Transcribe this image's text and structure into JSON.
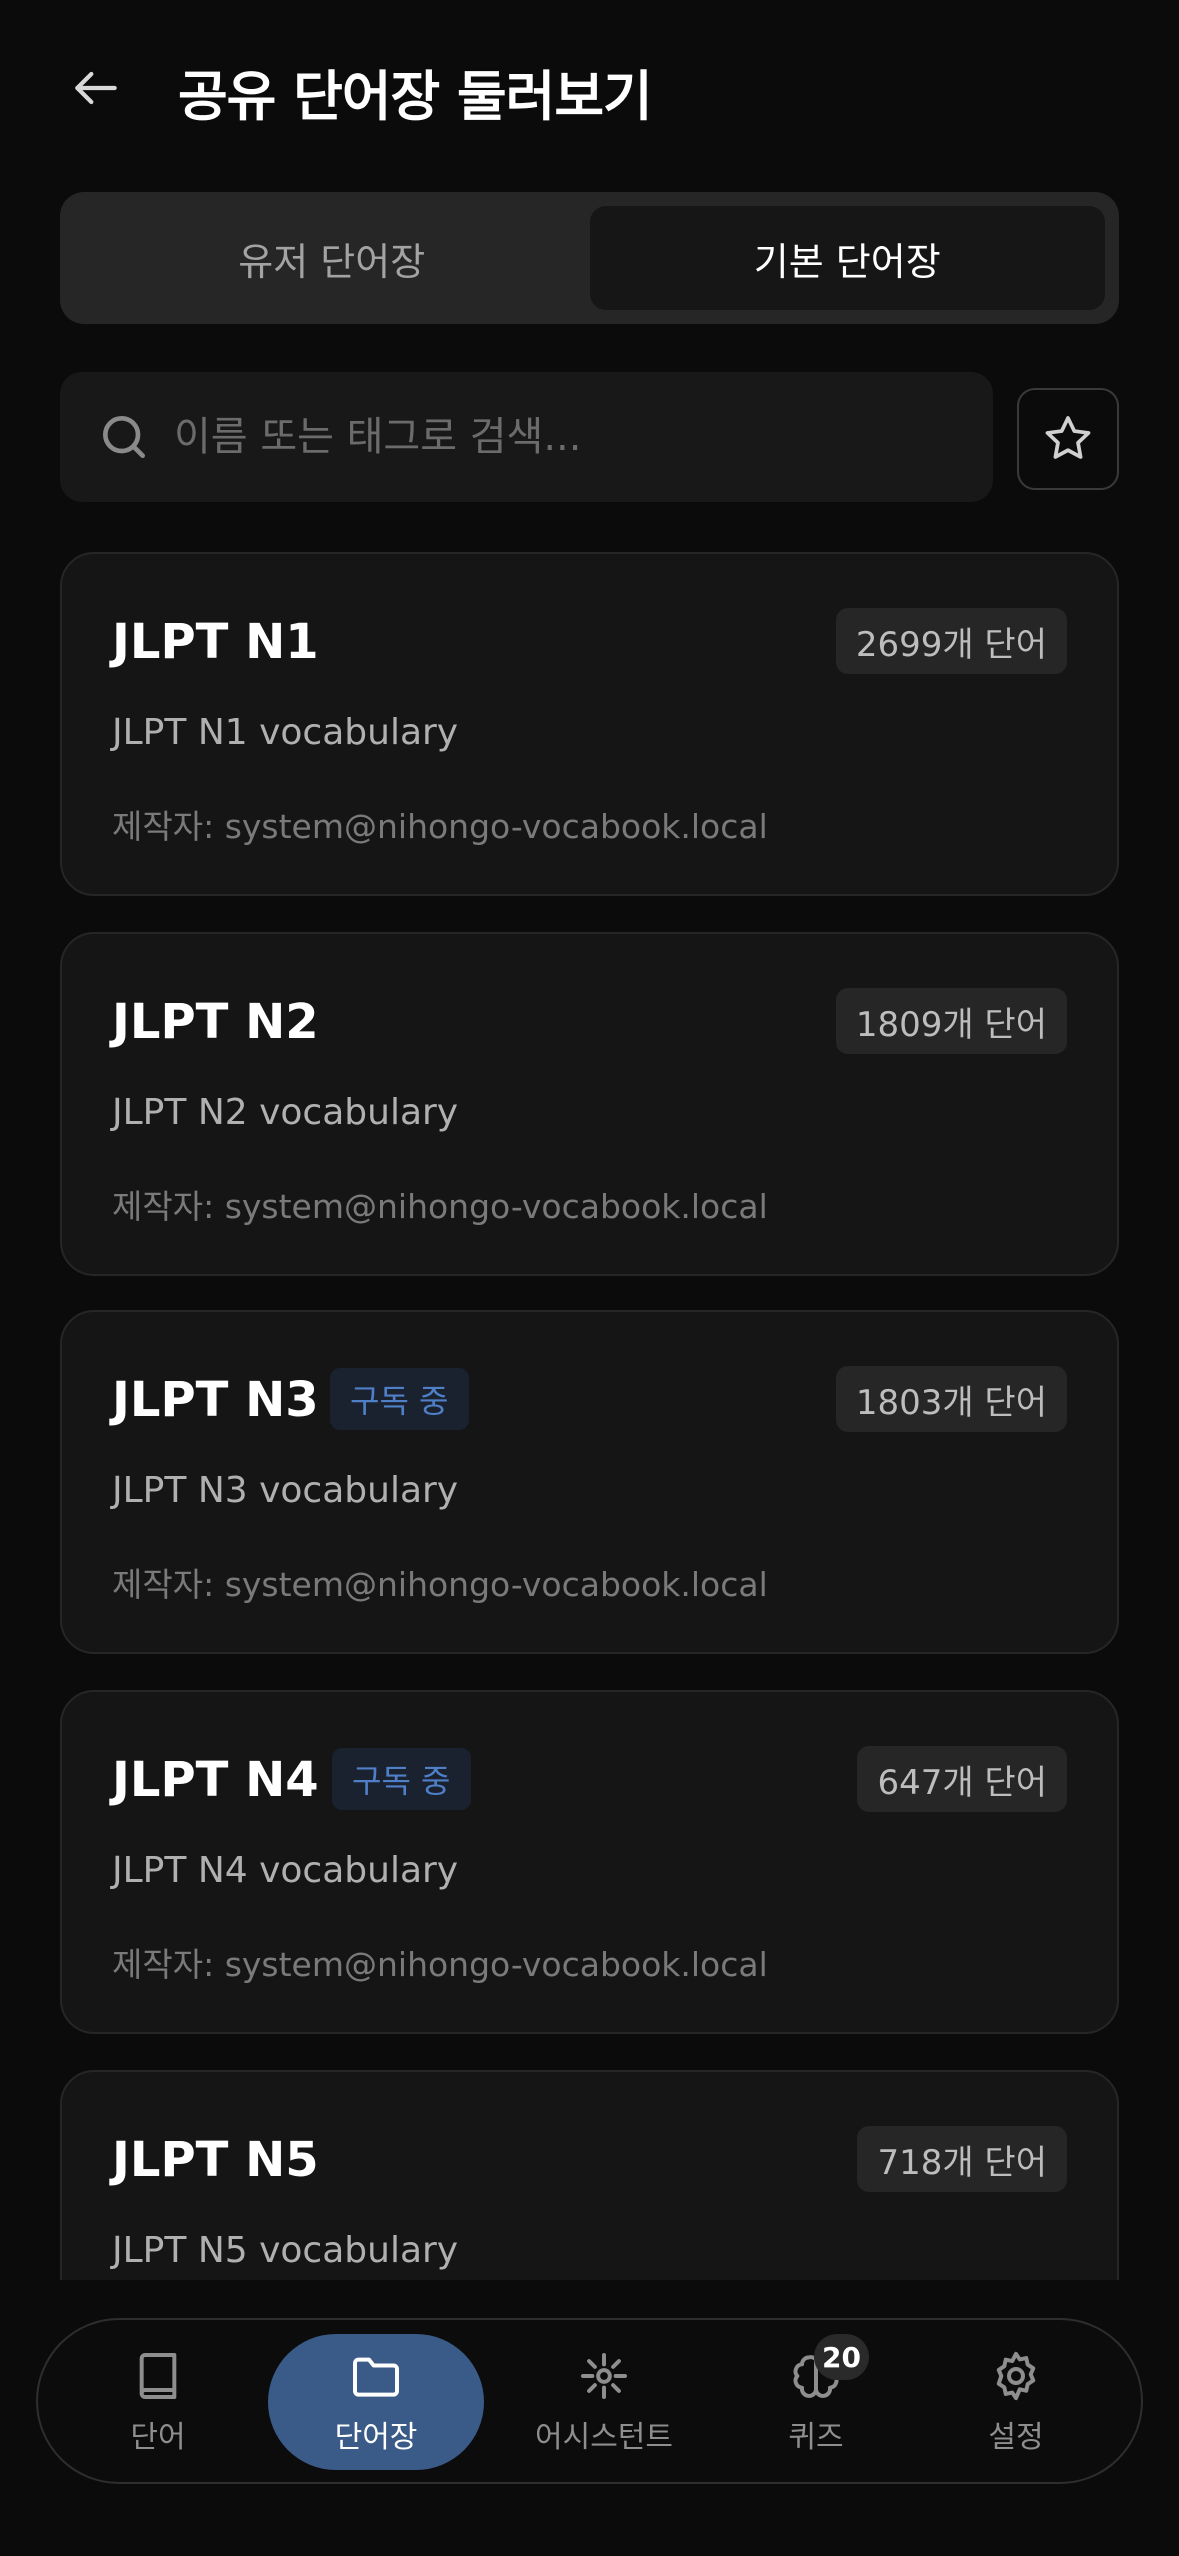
{
  "header": {
    "title": "공유 단어장 둘러보기",
    "back_icon": "arrow-left-icon"
  },
  "tabs": [
    {
      "label": "유저 단어장",
      "active": false
    },
    {
      "label": "기본 단어장",
      "active": true
    }
  ],
  "search": {
    "placeholder": "이름 또는 태그로 검색...",
    "value": ""
  },
  "favorites_icon": "star-icon",
  "vocabooks": [
    {
      "title": "JLPT N1",
      "badge": "",
      "count": "2699개 단어",
      "description": "JLPT N1 vocabulary",
      "author": "제작자: system@nihongo-vocabook.local"
    },
    {
      "title": "JLPT N2",
      "badge": "",
      "count": "1809개 단어",
      "description": "JLPT N2 vocabulary",
      "author": "제작자: system@nihongo-vocabook.local"
    },
    {
      "title": "JLPT N3",
      "badge": "구독 중",
      "count": "1803개 단어",
      "description": "JLPT N3 vocabulary",
      "author": "제작자: system@nihongo-vocabook.local"
    },
    {
      "title": "JLPT N4",
      "badge": "구독 중",
      "count": "647개 단어",
      "description": "JLPT N4 vocabulary",
      "author": "제작자: system@nihongo-vocabook.local"
    },
    {
      "title": "JLPT N5",
      "badge": "",
      "count": "718개 단어",
      "description": "JLPT N5 vocabulary",
      "author": ""
    }
  ],
  "bottom_nav": [
    {
      "label": "단어",
      "icon": "book-icon",
      "active": false
    },
    {
      "label": "단어장",
      "icon": "folder-icon",
      "active": true
    },
    {
      "label": "어시스턴트",
      "icon": "sparkle-icon",
      "active": false
    },
    {
      "label": "퀴즈",
      "icon": "brain-icon",
      "active": false,
      "badge": "20"
    },
    {
      "label": "설정",
      "icon": "gear-icon",
      "active": false
    }
  ],
  "colors": {
    "background": "#0b0b0b",
    "card": "#151515",
    "accent": "#3a5a88",
    "badge_text": "#4f7fc6"
  }
}
